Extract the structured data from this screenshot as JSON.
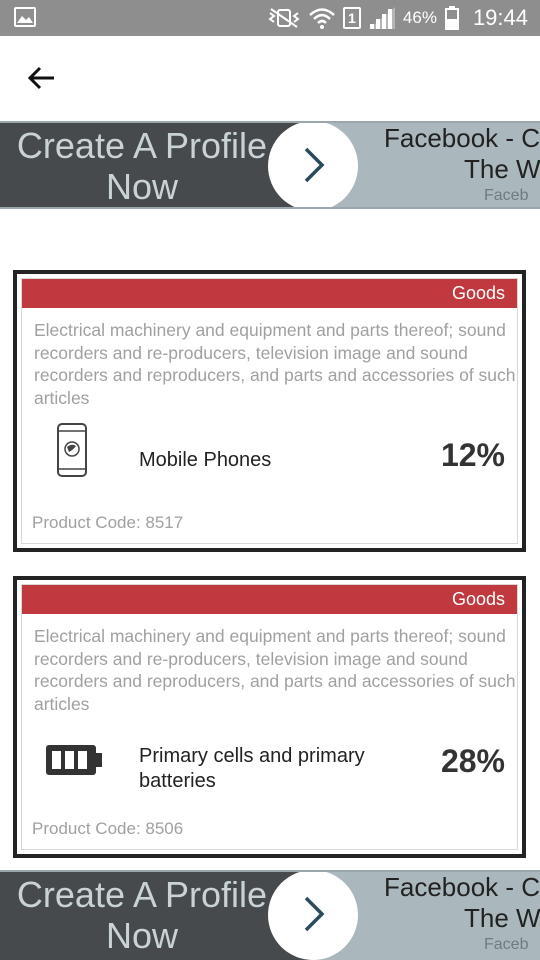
{
  "status_bar": {
    "battery_percent": "46%",
    "time": "19:44",
    "sim_label": "1",
    "icons": [
      "gallery-icon",
      "mute-vibrate-icon",
      "wifi-icon",
      "sim-icon",
      "signal-icon",
      "battery-icon"
    ]
  },
  "app_bar": {
    "back_icon": "arrow-left-icon"
  },
  "ad_top": {
    "headline": "Create A Profile Now",
    "title_line1": "Facebook - C",
    "title_line2": "The W",
    "subtitle": "Faceb"
  },
  "cards": [
    {
      "tag": "Goods",
      "description": "Electrical machinery and equipment and parts thereof; sound recorders and re-producers, television image and sound recorders and reproducers, and parts and accessories of such articles",
      "icon": "mobile-phone-icon",
      "name": "Mobile Phones",
      "percent": "12%",
      "product_code": "Product Code: 8517"
    },
    {
      "tag": "Goods",
      "description": "Electrical machinery and equipment and parts thereof; sound recorders and re-producers, television image and sound recorders and reproducers, and parts and accessories of such articles",
      "icon": "battery-icon",
      "name": "Primary cells and primary batteries",
      "percent": "28%",
      "product_code": "Product Code: 8506"
    }
  ],
  "ad_bottom": {
    "headline": "Create A Profile Now",
    "title_line1": "Facebook - C",
    "title_line2": "The W",
    "subtitle": "Faceb"
  },
  "colors": {
    "status_bar": "#8e8e8e",
    "tag_red": "#c0393f",
    "ad_dark": "#474a4c",
    "ad_light": "#aab8bd"
  }
}
